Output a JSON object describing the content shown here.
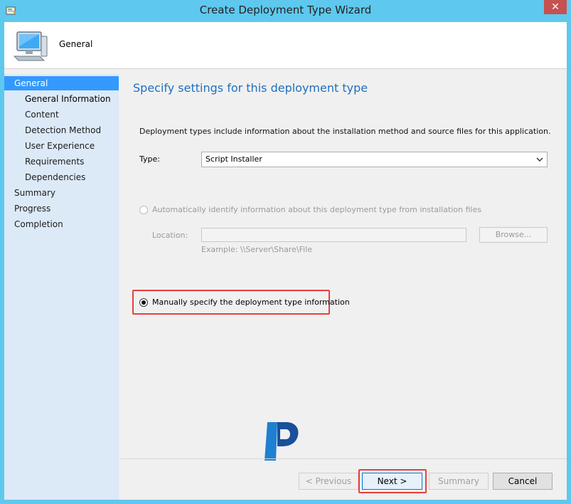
{
  "window": {
    "title": "Create Deployment Type Wizard",
    "close_label": "✕"
  },
  "banner": {
    "title": "General"
  },
  "nav": {
    "items": [
      {
        "label": "General",
        "level": 0,
        "selected": true
      },
      {
        "label": "General Information",
        "level": 1,
        "current": true
      },
      {
        "label": "Content",
        "level": 1
      },
      {
        "label": "Detection Method",
        "level": 1
      },
      {
        "label": "User Experience",
        "level": 1
      },
      {
        "label": "Requirements",
        "level": 1
      },
      {
        "label": "Dependencies",
        "level": 1
      },
      {
        "label": "Summary",
        "level": 0
      },
      {
        "label": "Progress",
        "level": 0
      },
      {
        "label": "Completion",
        "level": 0
      }
    ]
  },
  "main": {
    "heading": "Specify settings for this deployment type",
    "description": "Deployment types include information about the installation method and source files for this application.",
    "type_label": "Type:",
    "type_value": "Script Installer",
    "auto_radio_label": "Automatically identify information about this deployment type from installation files",
    "location_label": "Location:",
    "location_value": "",
    "browse_label": "Browse...",
    "example_text": "Example: \\\\Server\\Share\\File",
    "manual_radio_label": "Manually specify the deployment type information"
  },
  "footer": {
    "previous_label": "< Previous",
    "next_label": "Next >",
    "summary_label": "Summary",
    "cancel_label": "Cancel"
  },
  "colors": {
    "titlebar": "#5ec8ee",
    "accent": "#3399ff",
    "heading": "#1f6fbf",
    "highlight": "#e8403c",
    "close": "#c75050"
  }
}
